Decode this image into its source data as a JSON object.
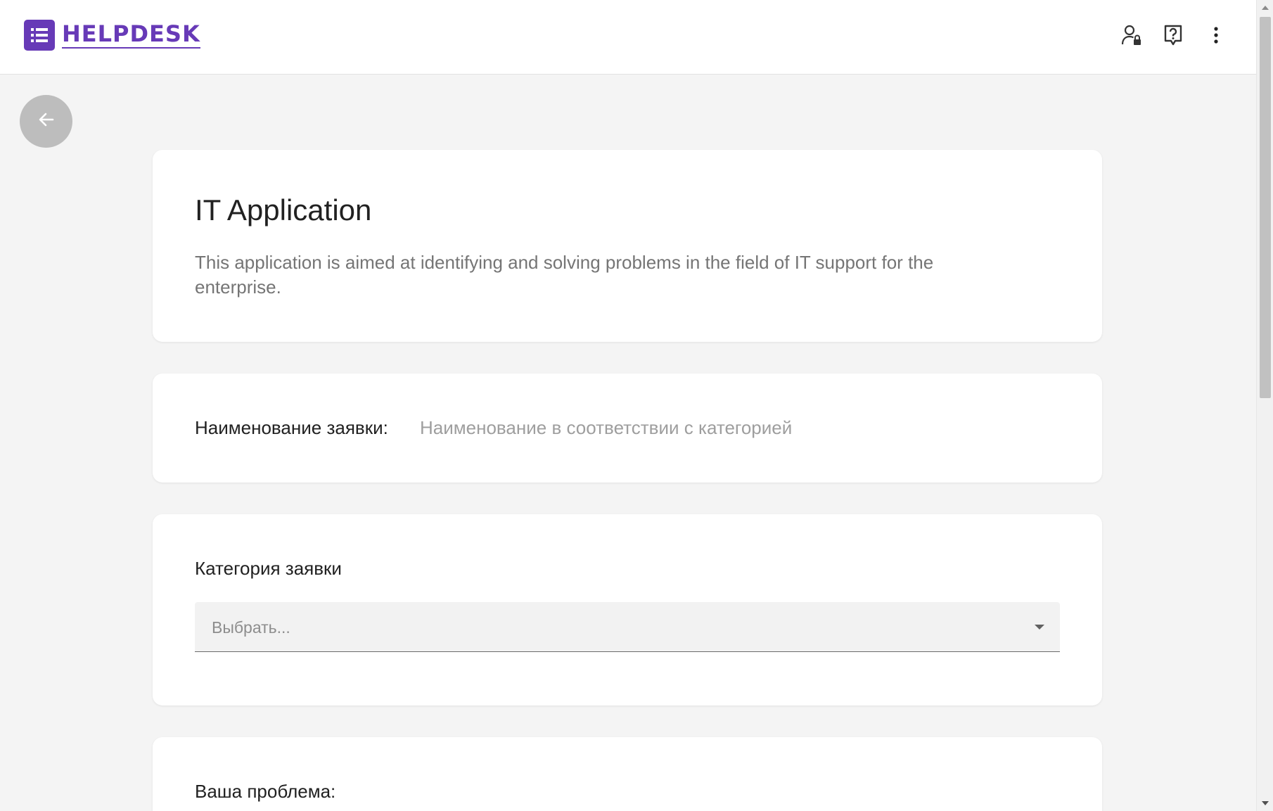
{
  "header": {
    "logo_text": "HELPDESK",
    "brand_color": "#673ab7",
    "actions": [
      {
        "icon": "user-lock-icon"
      },
      {
        "icon": "help-icon"
      },
      {
        "icon": "more-vert-icon"
      }
    ]
  },
  "back_button": {
    "icon": "arrow-left-icon"
  },
  "form": {
    "title": "IT Application",
    "description": "This application is aimed at identifying and solving problems in the field of IT support for the enterprise.",
    "name_field": {
      "label": "Наименование заявки:",
      "value": "",
      "placeholder": "Наименование в соответствии с категорией"
    },
    "category_field": {
      "label": "Категория заявки",
      "selected": "Выбрать..."
    },
    "problem_field": {
      "label": "Ваша проблема:"
    }
  }
}
